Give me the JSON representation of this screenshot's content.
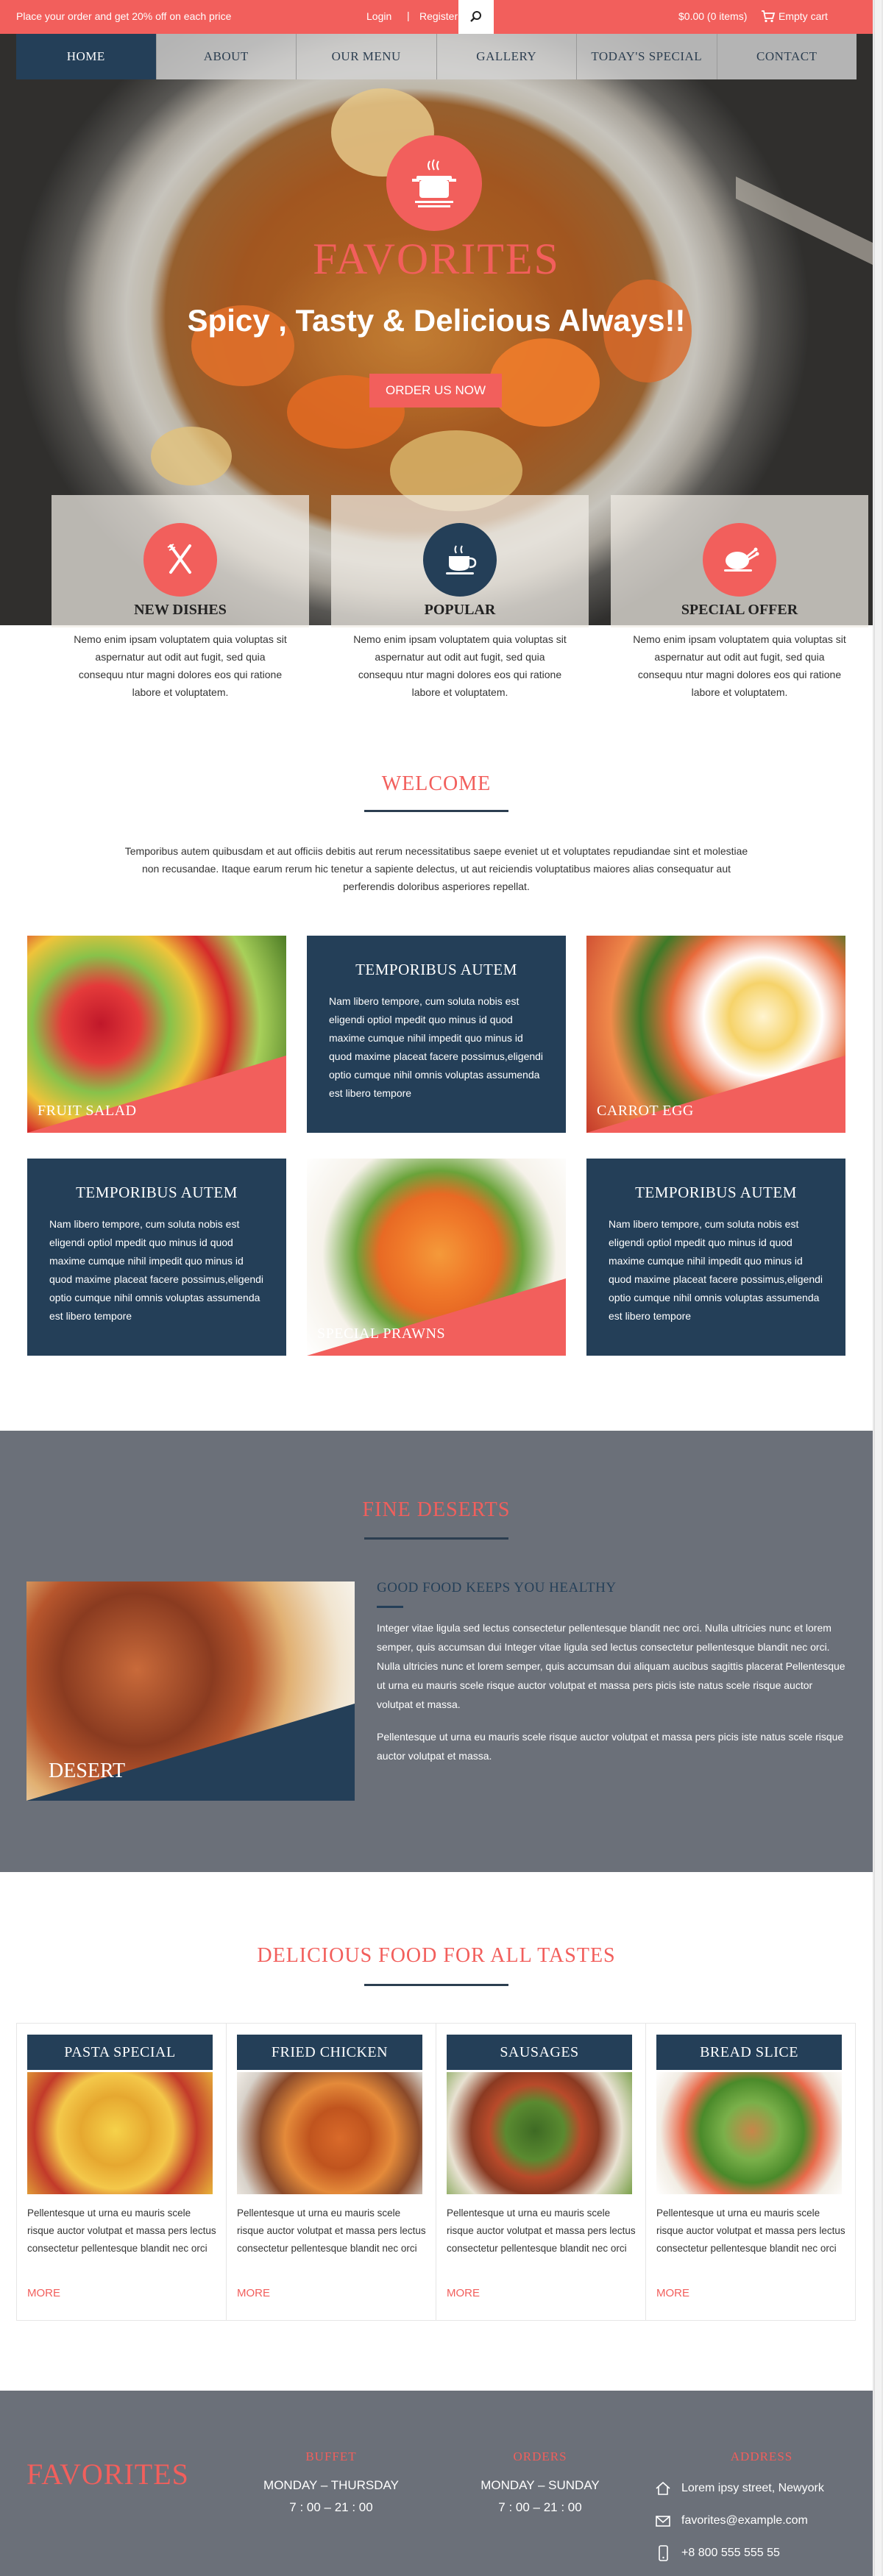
{
  "topbar": {
    "promo": "Place your order and get 20% off on each price",
    "login": "Login",
    "separator": "|",
    "register": "Register",
    "cart_total": "$0.00 (0 items)",
    "empty_cart": "Empty cart",
    "search_icon": "search-icon",
    "cart_icon": "cart-icon"
  },
  "nav": {
    "items": [
      "HOME",
      "ABOUT",
      "OUR MENU",
      "GALLERY",
      "TODAY'S SPECIAL",
      "CONTACT"
    ],
    "active": "HOME"
  },
  "hero": {
    "logo_icon": "cooking-pot-icon",
    "title": "FAVORITES",
    "tagline": "Spicy , Tasty & Delicious Always!!",
    "order_button": "ORDER US NOW"
  },
  "features": [
    {
      "icon": "fork-knife-icon",
      "icon_bg": "#f25f5c",
      "title": "NEW DISHES",
      "text": "Nemo enim ipsam voluptatem quia voluptas sit aspernatur aut odit aut fugit, sed quia consequu ntur magni dolores eos qui ratione labore et voluptatem."
    },
    {
      "icon": "coffee-cup-icon",
      "icon_bg": "#243f58",
      "title": "POPULAR",
      "text": "Nemo enim ipsam voluptatem quia voluptas sit aspernatur aut odit aut fugit, sed quia consequu ntur magni dolores eos qui ratione labore et voluptatem."
    },
    {
      "icon": "roast-chicken-icon",
      "icon_bg": "#f25f5c",
      "title": "SPECIAL OFFER",
      "text": "Nemo enim ipsam voluptatem quia voluptas sit aspernatur aut odit aut fugit, sed quia consequu ntur magni dolores eos qui ratione labore et voluptatem."
    }
  ],
  "welcome": {
    "title": "WELCOME",
    "text": "Temporibus autem quibusdam et aut officiis debitis aut rerum necessitatibus saepe eveniet ut et voluptates repudiandae sint et molestiae non recusandae. Itaque earum rerum hic tenetur a sapiente delectus, ut aut reiciendis voluptatibus maiores alias consequatur aut perferendis doloribus asperiores repellat.",
    "tiles": [
      {
        "type": "image",
        "label": "FRUIT SALAD"
      },
      {
        "type": "text",
        "title": "TEMPORIBUS AUTEM",
        "text": "Nam libero tempore, cum soluta nobis est eligendi optiol mpedit quo minus id quod maxime cumque nihil impedit quo minus id quod maxime placeat facere possimus,eligendi optio cumque nihil omnis voluptas assumenda est libero tempore"
      },
      {
        "type": "image",
        "label": "CARROT EGG"
      },
      {
        "type": "text",
        "title": "TEMPORIBUS AUTEM",
        "text": "Nam libero tempore, cum soluta nobis est eligendi optiol mpedit quo minus id quod maxime cumque nihil impedit quo minus id quod maxime placeat facere possimus,eligendi optio cumque nihil omnis voluptas assumenda est libero tempore"
      },
      {
        "type": "image",
        "label": "SPECIAL PRAWNS"
      },
      {
        "type": "text",
        "title": "TEMPORIBUS AUTEM",
        "text": "Nam libero tempore, cum soluta nobis est eligendi optiol mpedit quo minus id quod maxime cumque nihil impedit quo minus id quod maxime placeat facere possimus,eligendi optio cumque nihil omnis voluptas assumenda est libero tempore"
      }
    ]
  },
  "deserts": {
    "title": "FINE DESERTS",
    "image_label": "DESERT",
    "subtitle": "GOOD FOOD KEEPS YOU HEALTHY",
    "para1": "Integer vitae ligula sed lectus consectetur pellentesque blandit nec orci. Nulla ultricies nunc et lorem semper, quis accumsan dui Integer vitae ligula sed lectus consectetur pellentesque blandit nec orci. Nulla ultricies nunc et lorem semper, quis accumsan dui aliquam aucibus sagittis placerat Pellentesque ut urna eu mauris scele risque auctor volutpat et massa pers picis iste natus scele risque auctor volutpat et massa.",
    "para2": "Pellentesque ut urna eu mauris scele risque auctor volutpat et massa pers picis iste natus scele risque auctor volutpat et massa."
  },
  "food": {
    "title": "DELICIOUS FOOD FOR ALL TASTES",
    "cards": [
      {
        "title": "PASTA SPECIAL",
        "text": "Pellentesque ut urna eu mauris scele risque auctor volutpat et massa pers lectus consectetur pellentesque blandit nec orci",
        "more": "MORE"
      },
      {
        "title": "FRIED CHICKEN",
        "text": "Pellentesque ut urna eu mauris scele risque auctor volutpat et massa pers lectus consectetur pellentesque blandit nec orci",
        "more": "MORE"
      },
      {
        "title": "SAUSAGES",
        "text": "Pellentesque ut urna eu mauris scele risque auctor volutpat et massa pers lectus consectetur pellentesque blandit nec orci",
        "more": "MORE"
      },
      {
        "title": "BREAD SLICE",
        "text": "Pellentesque ut urna eu mauris scele risque auctor volutpat et massa pers lectus consectetur pellentesque blandit nec orci",
        "more": "MORE"
      }
    ]
  },
  "footer": {
    "logo": "FAVORITES",
    "buffet": {
      "heading": "BUFFET",
      "days": "MONDAY – THURSDAY",
      "hours": "7 : 00 – 21 : 00"
    },
    "orders": {
      "heading": "ORDERS",
      "days": "MONDAY – SUNDAY",
      "hours": "7 : 00 – 21 : 00"
    },
    "address": {
      "heading": "ADDRESS",
      "street": "Lorem ipsy street, Newyork",
      "email": "favorites@example.com",
      "phone": "+8 800 555 555 55"
    }
  },
  "colors": {
    "accent": "#f25f5c",
    "navy": "#243f58",
    "slate": "#6b7079"
  }
}
